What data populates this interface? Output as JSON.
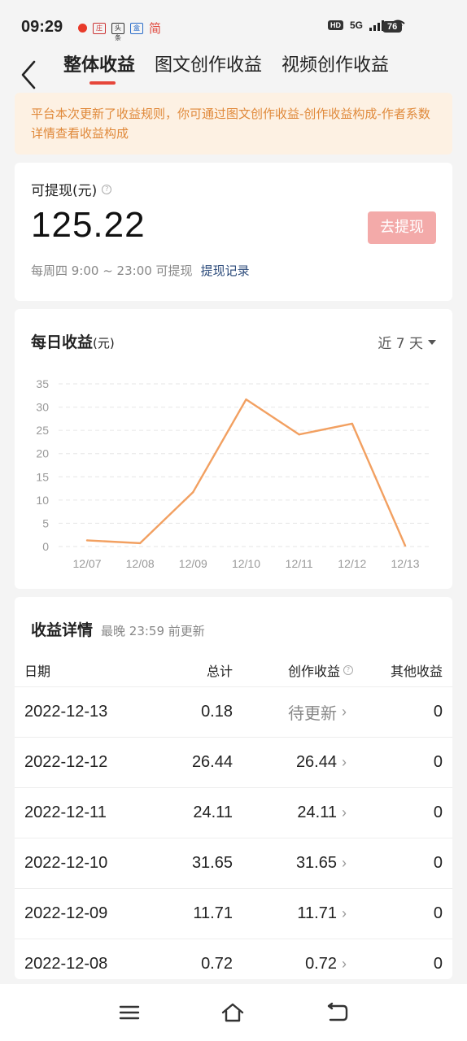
{
  "status_bar": {
    "time": "09:29",
    "notif_badges": [
      "庄",
      "头条",
      "盒"
    ],
    "notif_jian": "简",
    "hd": "HD",
    "network": "5G",
    "battery": "76"
  },
  "tabs": [
    "整体收益",
    "图文创作收益",
    "视频创作收益"
  ],
  "notice": "平台本次更新了收益规则，你可通过图文创作收益-创作收益构成-作者系数详情查看收益构成",
  "withdraw": {
    "label": "可提现(元)",
    "amount": "125.22",
    "button": "去提现",
    "schedule": "每周四 9:00 ~ 23:00 可提现",
    "record_link": "提现记录"
  },
  "daily": {
    "title": "每日收益",
    "unit": "(元)",
    "range": "近 7 天"
  },
  "chart_data": {
    "type": "line",
    "title": "每日收益(元)",
    "categories": [
      "12/07",
      "12/08",
      "12/09",
      "12/10",
      "12/11",
      "12/12",
      "12/13"
    ],
    "values": [
      1.32,
      0.72,
      11.71,
      31.65,
      24.11,
      26.44,
      0.18
    ],
    "y_ticks": [
      35,
      30,
      25,
      20,
      15,
      10,
      5,
      0
    ],
    "ylim": [
      0,
      35
    ],
    "grid": true,
    "line_color": "#f2a061"
  },
  "details": {
    "title": "收益详情",
    "subtitle": "最晚 23:59 前更新",
    "headers": {
      "date": "日期",
      "total": "总计",
      "creation": "创作收益",
      "other": "其他收益"
    },
    "rows": [
      {
        "date": "2022-12-13",
        "total": "0.18",
        "creation": "待更新",
        "other": "0"
      },
      {
        "date": "2022-12-12",
        "total": "26.44",
        "creation": "26.44",
        "other": "0"
      },
      {
        "date": "2022-12-11",
        "total": "24.11",
        "creation": "24.11",
        "other": "0"
      },
      {
        "date": "2022-12-10",
        "total": "31.65",
        "creation": "31.65",
        "other": "0"
      },
      {
        "date": "2022-12-09",
        "total": "11.71",
        "creation": "11.71",
        "other": "0"
      },
      {
        "date": "2022-12-08",
        "total": "0.72",
        "creation": "0.72",
        "other": "0"
      }
    ]
  },
  "colors": {
    "accent": "#e6463a",
    "notice_bg": "#fdf1e3",
    "notice_text": "#e0893a",
    "button_bg": "#f3aaa9",
    "link": "#2b4a7a"
  }
}
